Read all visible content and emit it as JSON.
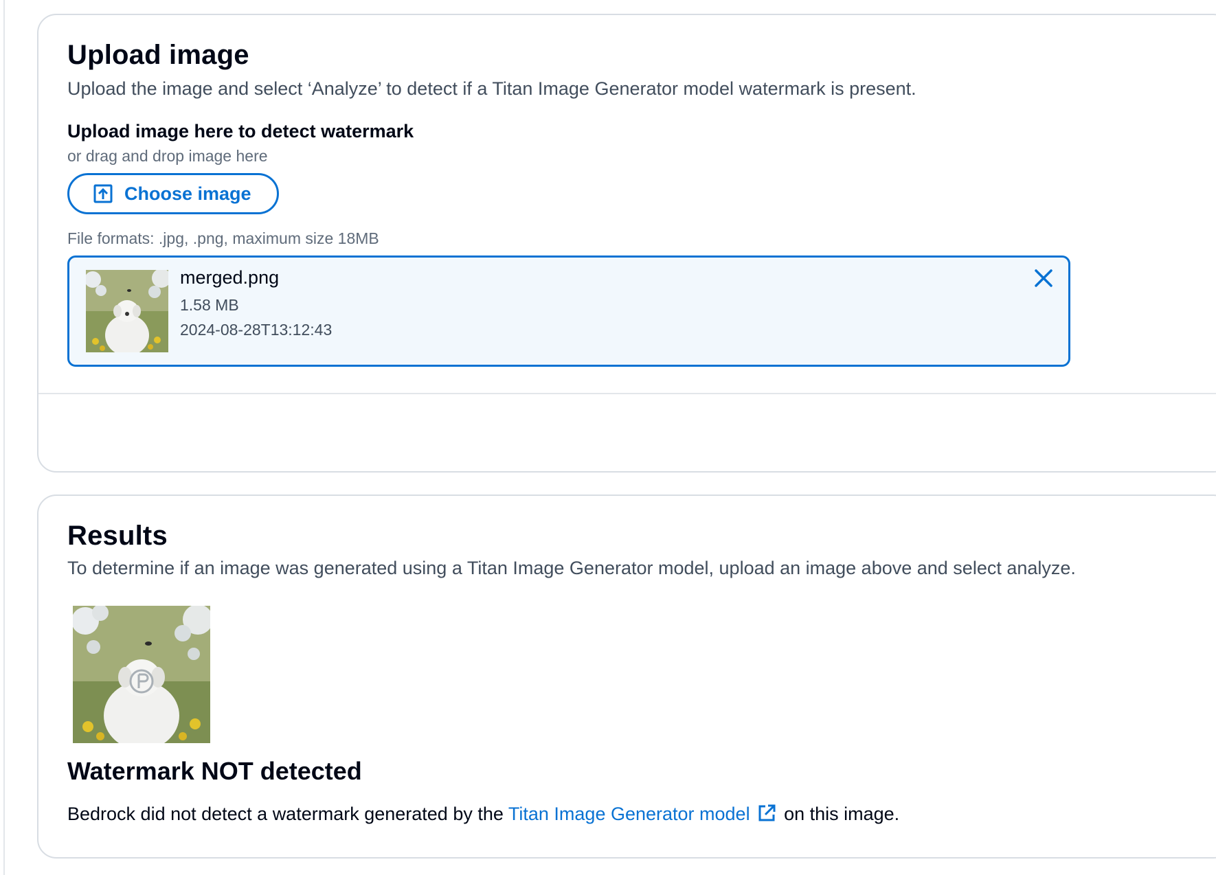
{
  "upload_section": {
    "title": "Upload image",
    "description": "Upload the image and select ‘Analyze’ to detect if a Titan Image Generator model watermark is present.",
    "field_label": "Upload image here to detect watermark",
    "field_hint": "or drag and drop image here",
    "choose_button_label": "Choose image",
    "constraint_text": "File formats: .jpg, .png, maximum size 18MB",
    "file": {
      "name": "merged.png",
      "size": "1.58 MB",
      "last_modified": "2024-08-28T13:12:43"
    }
  },
  "results_section": {
    "title": "Results",
    "description": "To determine if an image was generated using a Titan Image Generator model, upload an image above and select analyze.",
    "status_heading": "Watermark NOT detected",
    "message_before": "Bedrock did not detect a watermark generated by the ",
    "link_text": "Titan Image Generator model",
    "message_after": " on this image."
  },
  "icons": {
    "upload": "upload-icon",
    "dismiss": "close-icon",
    "external_link": "external-link-icon"
  },
  "colors": {
    "accent": "#0972d3",
    "token_background": "#f2f8fd",
    "border": "#d8dde3"
  }
}
